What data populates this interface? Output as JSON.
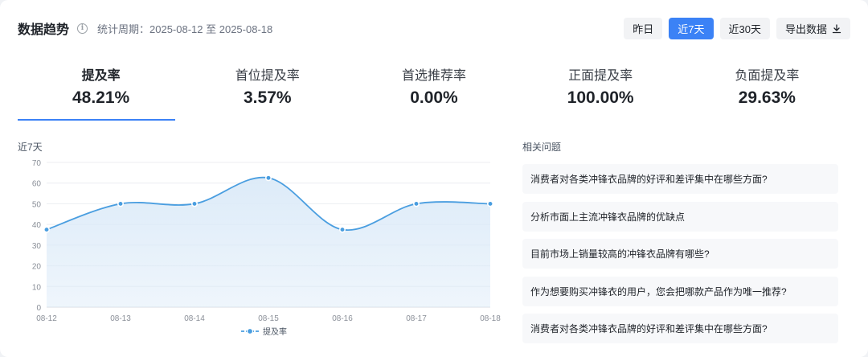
{
  "header": {
    "title": "数据趋势",
    "period": "统计周期：2025-08-12 至 2025-08-18"
  },
  "buttons": {
    "yesterday": "昨日",
    "last7": "近7天",
    "last30": "近30天",
    "export": "导出数据",
    "active": "last7"
  },
  "metrics": [
    {
      "label": "提及率",
      "value": "48.21%",
      "active": true
    },
    {
      "label": "首位提及率",
      "value": "3.57%",
      "active": false
    },
    {
      "label": "首选推荐率",
      "value": "0.00%",
      "active": false
    },
    {
      "label": "正面提及率",
      "value": "100.00%",
      "active": false
    },
    {
      "label": "负面提及率",
      "value": "29.63%",
      "active": false
    }
  ],
  "chart_label": "近7天",
  "chart_data": {
    "type": "area",
    "x": [
      "08-12",
      "08-13",
      "08-14",
      "08-15",
      "08-16",
      "08-17",
      "08-18"
    ],
    "series": [
      {
        "name": "提及率",
        "values": [
          37.5,
          50,
          50,
          62.5,
          37.5,
          50,
          50
        ]
      }
    ],
    "ylim": [
      0,
      70
    ],
    "yticks": [
      0,
      10,
      20,
      30,
      40,
      50,
      60,
      70
    ],
    "grid": true,
    "legend": "bottom-center",
    "colors": {
      "line": "#4a9ee0",
      "fill": "#dbeaf8"
    }
  },
  "questions": {
    "title": "相关问题",
    "items": [
      "消费者对各类冲锋衣品牌的好评和差评集中在哪些方面?",
      "分析市面上主流冲锋衣品牌的优缺点",
      "目前市场上销量较高的冲锋衣品牌有哪些?",
      "作为想要购买冲锋衣的用户，您会把哪款产品作为唯一推荐?",
      "消费者对各类冲锋衣品牌的好评和差评集中在哪些方面?"
    ]
  },
  "colors": {
    "accent": "#3b82f6"
  }
}
